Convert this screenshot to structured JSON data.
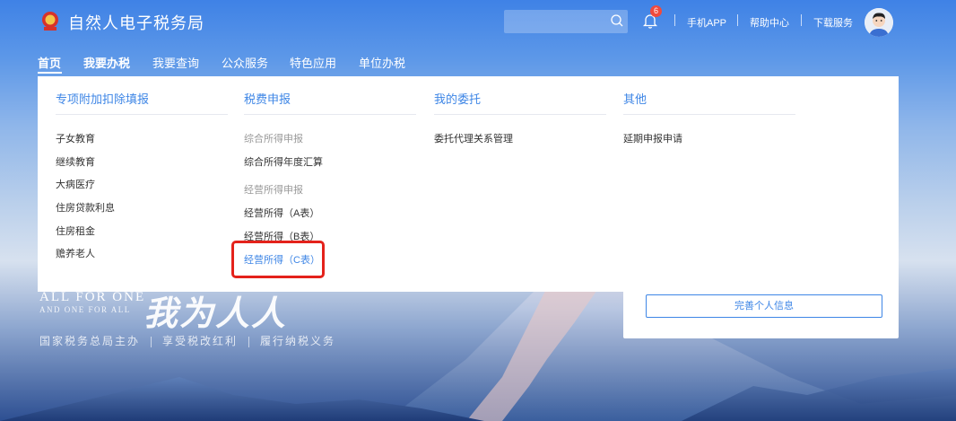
{
  "header": {
    "site_title": "自然人电子税务局",
    "search_placeholder": "",
    "notification_count": "6",
    "links": {
      "mobile_app": "手机APP",
      "help_center": "帮助中心",
      "download_service": "下载服务"
    }
  },
  "nav": {
    "items": [
      "首页",
      "我要办税",
      "我要查询",
      "公众服务",
      "特色应用",
      "单位办税"
    ],
    "active_index": 0
  },
  "dropdown": {
    "columns": [
      {
        "title": "专项附加扣除填报",
        "items": [
          {
            "label": "子女教育"
          },
          {
            "label": "继续教育"
          },
          {
            "label": "大病医疗"
          },
          {
            "label": "住房贷款利息"
          },
          {
            "label": "住房租金"
          },
          {
            "label": "赡养老人"
          }
        ]
      },
      {
        "title": "税费申报",
        "groups": [
          {
            "label": "综合所得申报",
            "items": [
              "综合所得年度汇算"
            ]
          },
          {
            "label": "经营所得申报",
            "items": [
              "经营所得（A表）",
              "经营所得（B表）",
              "经营所得（C表）"
            ]
          }
        ],
        "highlighted_item": "经营所得（C表）"
      },
      {
        "title": "我的委托",
        "items": [
          {
            "label": "委托代理关系管理"
          }
        ]
      },
      {
        "title": "其他",
        "items": [
          {
            "label": "延期申报申请"
          }
        ]
      }
    ]
  },
  "hero": {
    "slogan_line1": "ALL FOR ONE",
    "slogan_line2": "AND ONE FOR ALL",
    "calligraphy": "我为人人",
    "tagline": [
      "国家税务总局主办",
      "享受税改红利",
      "履行纳税义务"
    ]
  },
  "side_card": {
    "complete_profile_button": "完善个人信息"
  },
  "colors": {
    "accent": "#3e86e6",
    "highlight_box": "#e4221b",
    "badge": "#f04a3d"
  }
}
